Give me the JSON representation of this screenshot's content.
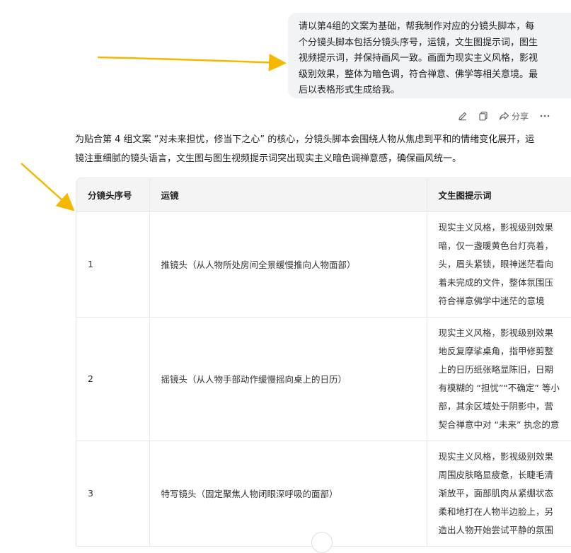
{
  "user_message": {
    "lines": [
      "请以第4组的文案为基础，帮我制作对应的分镜头脚本，每",
      "个分镜头脚本包括分镜头序号，运镜，文生图提示词，图生",
      "视频提示词，并保持画风一致。画面为现实主义风格，影视",
      "级别效果，整体为暗色调，符合禅意、佛学等相关意境。最",
      "后以表格形式生成给我。"
    ]
  },
  "actions": {
    "share_label": "分享"
  },
  "intro": {
    "lines": [
      "为贴合第 4 组文案 “对未来担忧，修当下之心” 的核心，分镜头脚本会围绕人物从焦虑到平和的情绪变化展开，运",
      "镜注重细腻的镜头语言，文生图与图生视频提示词突出现实主义暗色调禅意感，确保画风统一。"
    ]
  },
  "table": {
    "headers": [
      "分镜头序号",
      "运镜",
      "文生图提示词"
    ],
    "rows": [
      {
        "no": "1",
        "camera": "推镜头（从人物所处房间全景缓慢推向人物面部）",
        "prompt_lines": [
          "现实主义风格，影视级别效果",
          "暗，仅一盏暖黄色台灯亮着，",
          "头，眉头紧锁，眼神迷茫看向",
          "着未完成的文件，整体氛围压",
          "符合禅意佛学中迷茫的意境"
        ]
      },
      {
        "no": "2",
        "camera": "摇镜头（从人物手部动作缓慢摇向桌上的日历）",
        "prompt_lines": [
          "现实主义风格，影视级别效果",
          "地反复摩挲桌角，指甲修剪整",
          "上的日历纸张略显陈旧，日期",
          "有模糊的 “担忧”“不确定” 等小",
          "部，其余区域处于阴影中，营",
          "契合禅意中对 “未来” 执念的意"
        ]
      },
      {
        "no": "3",
        "camera": "特写镜头（固定聚焦人物闭眼深呼吸的面部）",
        "prompt_lines": [
          "现实主义风格，影视级别效果",
          "周围皮肤略显疲惫，长睫毛清",
          "渐放平，面部肌肉从紧绷状态",
          "柔和地打在人物半边脸上，另",
          "造出人物开始尝试平静的氛围"
        ]
      }
    ]
  },
  "colors": {
    "arrow": "#f5b800",
    "bubble_bg": "#f2f3f5",
    "header_bg": "#f4f4f5",
    "border": "#e8e8e8"
  }
}
